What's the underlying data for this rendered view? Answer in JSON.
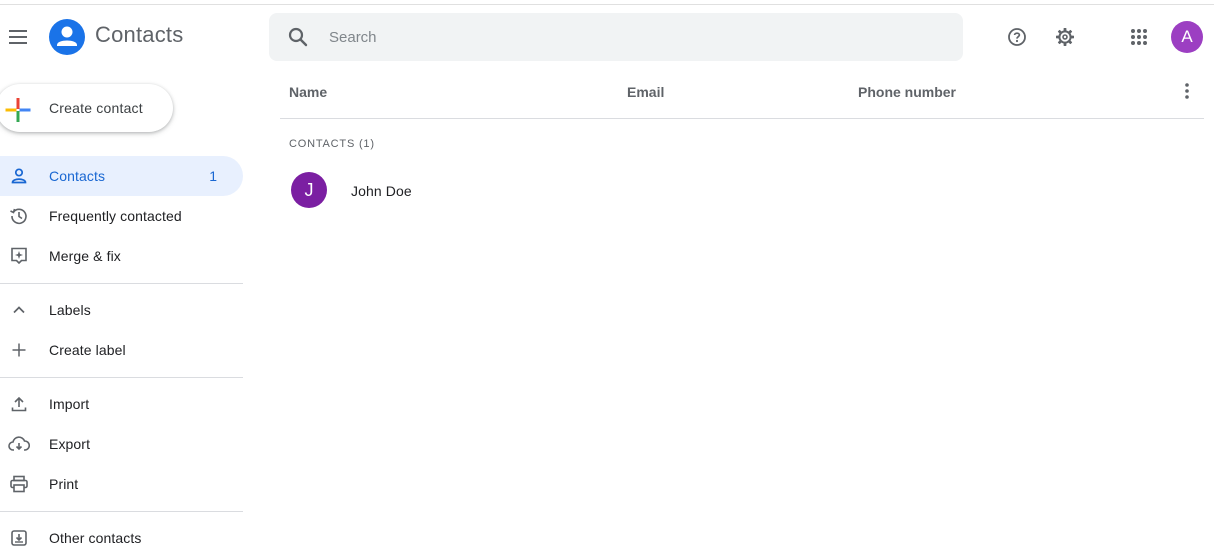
{
  "header": {
    "app_title": "Contacts",
    "search_placeholder": "Search",
    "search_value": "",
    "avatar_letter": "A",
    "avatar_color": "#9c3fc2",
    "icons": [
      "menu-icon",
      "contacts-logo-icon",
      "search-icon",
      "help-icon",
      "gear-icon",
      "apps-grid-icon"
    ]
  },
  "sidebar": {
    "create_contact_label": "Create contact",
    "items": [
      {
        "label": "Contacts",
        "count": "1",
        "icon": "person-icon",
        "active": true
      },
      {
        "label": "Frequently contacted",
        "icon": "history-icon"
      },
      {
        "label": "Merge & fix",
        "icon": "merge-fix-icon"
      }
    ],
    "labels_section": {
      "label": "Labels",
      "icon": "chevron-up-icon",
      "create_label": "Create label",
      "create_icon": "plus-icon"
    },
    "tools": [
      {
        "label": "Import",
        "icon": "upload-icon"
      },
      {
        "label": "Export",
        "icon": "cloud-download-icon"
      },
      {
        "label": "Print",
        "icon": "printer-icon"
      }
    ],
    "other_contacts": {
      "label": "Other contacts",
      "icon": "archive-icon"
    }
  },
  "table": {
    "columns": [
      "Name",
      "Email",
      "Phone number"
    ],
    "section_label": "CONTACTS (1)",
    "rows": [
      {
        "initial": "J",
        "name": "John Doe",
        "email": "",
        "phone": "",
        "avatar_color": "#7b1fa2"
      }
    ]
  },
  "colors": {
    "accent": "#1967d2",
    "active_bg": "#e8f0fe",
    "search_bg": "#f1f3f4"
  }
}
